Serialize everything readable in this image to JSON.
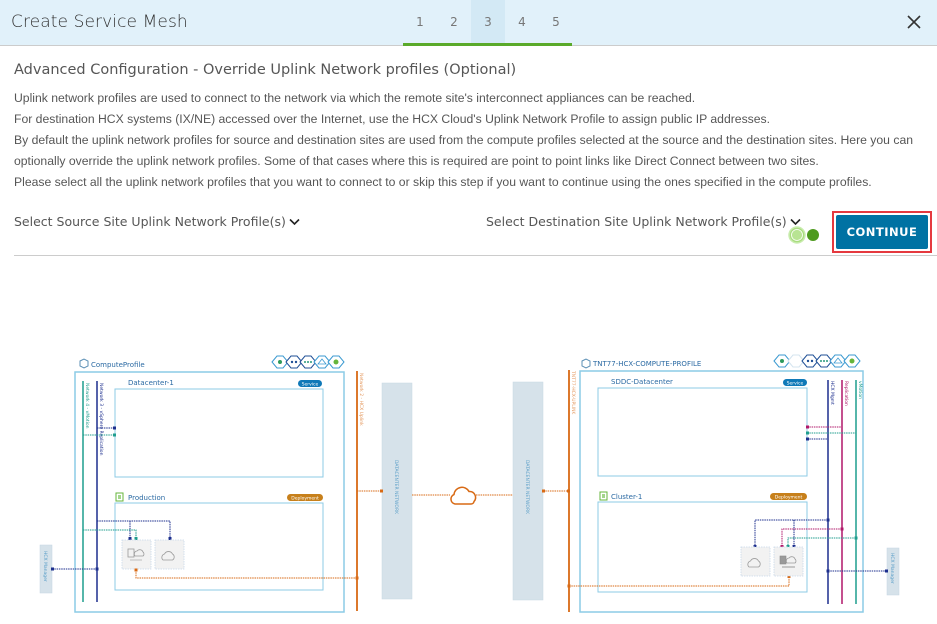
{
  "header": {
    "title": "Create Service Mesh",
    "steps": [
      "1",
      "2",
      "3",
      "4",
      "5"
    ],
    "active_step": 3,
    "progress_fraction": 1.0
  },
  "main": {
    "section_title": "Advanced Configuration - Override Uplink Network profiles (Optional)",
    "description": [
      "Uplink network profiles are used to connect to the network via which the remote site's interconnect appliances can be reached.",
      "For destination HCX systems (IX/NE) accessed over the Internet, use the HCX Cloud's Uplink Network Profile to assign public IP addresses.",
      "By default the uplink network profiles for source and destination sites are used from the compute profiles selected at the source and the destination sites. Here you can optionally override the uplink network profiles. Some of that cases where this is required are point to point links like Direct Connect between two sites.",
      "Please select all the uplink network profiles that you want to connect to or skip this step if you want to continue using the ones specified in the compute profiles."
    ],
    "source_select_label": "Select Source Site Uplink Network Profile(s)",
    "destination_select_label": "Select Destination Site Uplink Network Profile(s)",
    "continue_label": "CONTINUE"
  },
  "diagram": {
    "source": {
      "compute_profile": "ComputeProfile",
      "service_cluster": "Datacenter-1",
      "service_badge": "Service",
      "deployment_cluster": "Production",
      "deployment_badge": "Deployment",
      "networks": [
        "Network 4 - vMotion",
        "Network 3 - vSphere Replication",
        "Network 2 - HCX Uplink"
      ],
      "manager": "HCX Manager"
    },
    "destination": {
      "compute_profile": "TNT77-HCX-COMPUTE-PROFILE",
      "service_cluster": "SDDC-Datacenter",
      "service_badge": "Service",
      "deployment_cluster": "Cluster-1",
      "deployment_badge": "Deployment",
      "networks": [
        "TNT77-HCX-UPLINK",
        "HCX Mgmt",
        "Replication",
        "vMotion"
      ],
      "manager": "HCX Manager"
    },
    "datacenter_network_label": "DATACENTER NETWORK",
    "colors": {
      "uplink": "#d86a15",
      "mgmt": "#1d2f8e",
      "vmotion": "#1f9e8e",
      "replication": "#b0176a",
      "box_border": "#8ccbe6",
      "badge_service": "#0f79b8",
      "badge_deploy": "#c7801b",
      "dc_network": "#d6e2ea"
    }
  }
}
